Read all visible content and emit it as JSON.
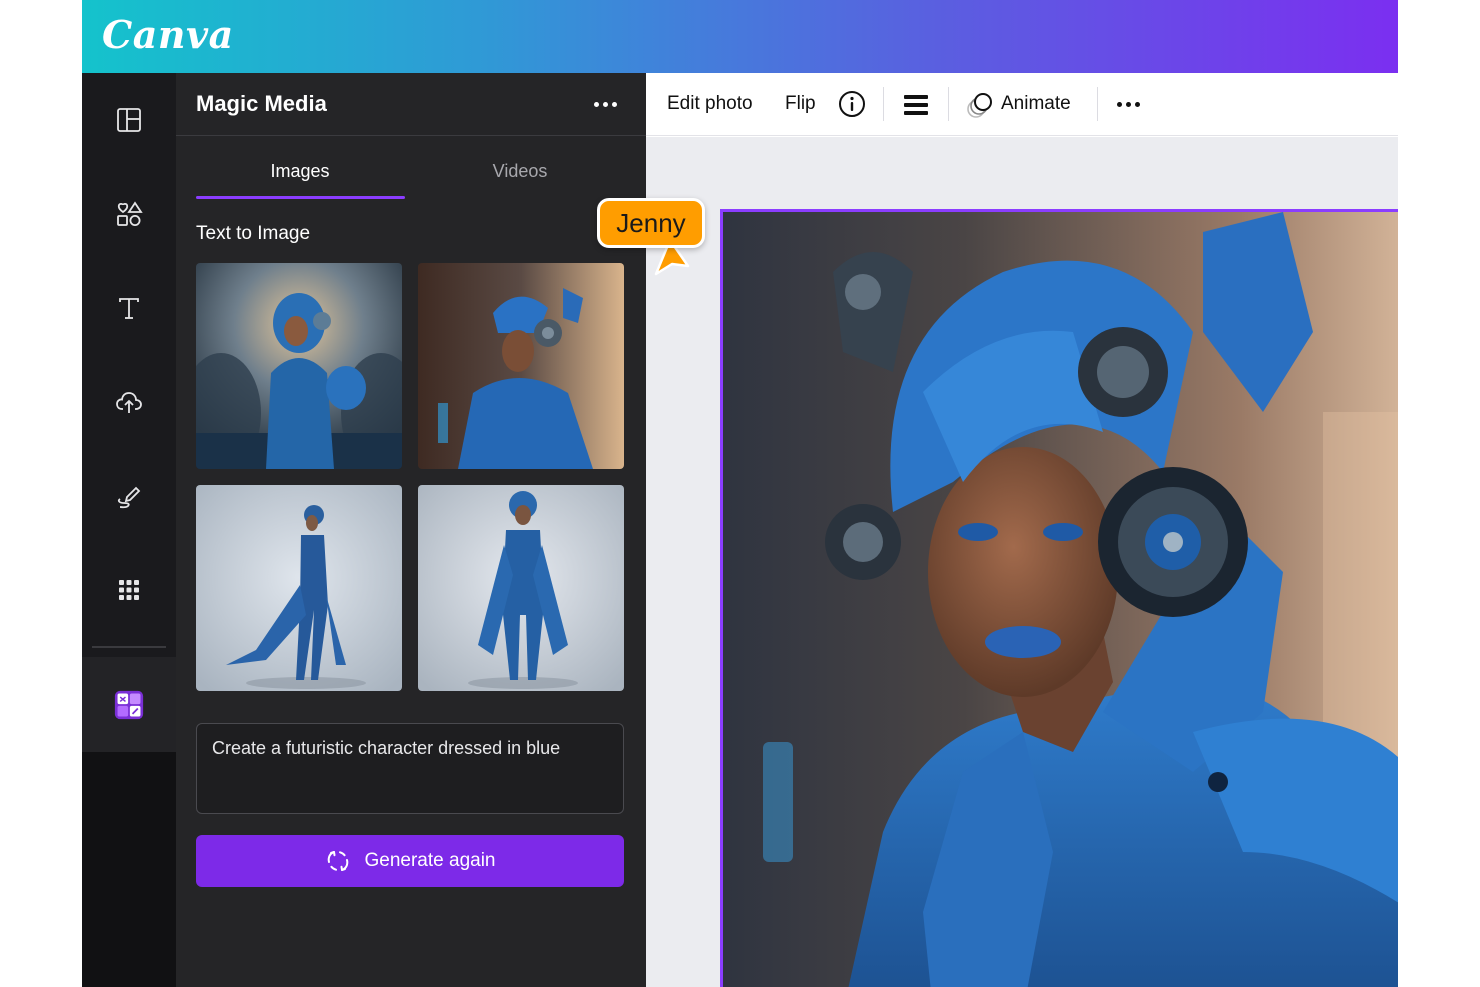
{
  "header": {
    "logo_text": "Canva"
  },
  "rail": {
    "items": [
      {
        "name": "Design",
        "icon": "layout-icon"
      },
      {
        "name": "Elements",
        "icon": "elements-icon"
      },
      {
        "name": "Text",
        "icon": "text-icon"
      },
      {
        "name": "Uploads",
        "icon": "upload-cloud-icon"
      },
      {
        "name": "Draw",
        "icon": "draw-icon"
      },
      {
        "name": "Apps",
        "icon": "apps-grid-icon"
      },
      {
        "name": "Magic Media",
        "icon": "magic-media-app-icon"
      }
    ]
  },
  "panel": {
    "title": "Magic Media",
    "more_icon": "more-horizontal-icon",
    "tabs": [
      {
        "label": "Images",
        "active": true
      },
      {
        "label": "Videos",
        "active": false
      }
    ],
    "section_label": "Text to Image",
    "results": [
      {
        "subject": "armored woman in blue suit, futuristic hangar"
      },
      {
        "subject": "woman with blue helmet and headphones, city bokeh"
      },
      {
        "subject": "full-body figure in blue suit with cape, side view"
      },
      {
        "subject": "full-body figure in blue suit with cape, front view"
      }
    ],
    "prompt": "Create a futuristic character dressed in blue",
    "generate_button": "Generate again",
    "generate_icon": "refresh-icon"
  },
  "toolbar": {
    "edit_photo": "Edit photo",
    "flip": "Flip",
    "info_icon": "info-icon",
    "position_icon": "position-icon",
    "animate": "Animate",
    "animate_icon": "animate-icon",
    "more_icon": "more-horizontal-icon"
  },
  "collaborator": {
    "name": "Jenny",
    "color": "#ff9d00"
  },
  "colors": {
    "accent": "#8b3dff",
    "button": "#7d2ae8",
    "panel_bg": "#252527",
    "rail_bg": "#1a1a1d"
  }
}
